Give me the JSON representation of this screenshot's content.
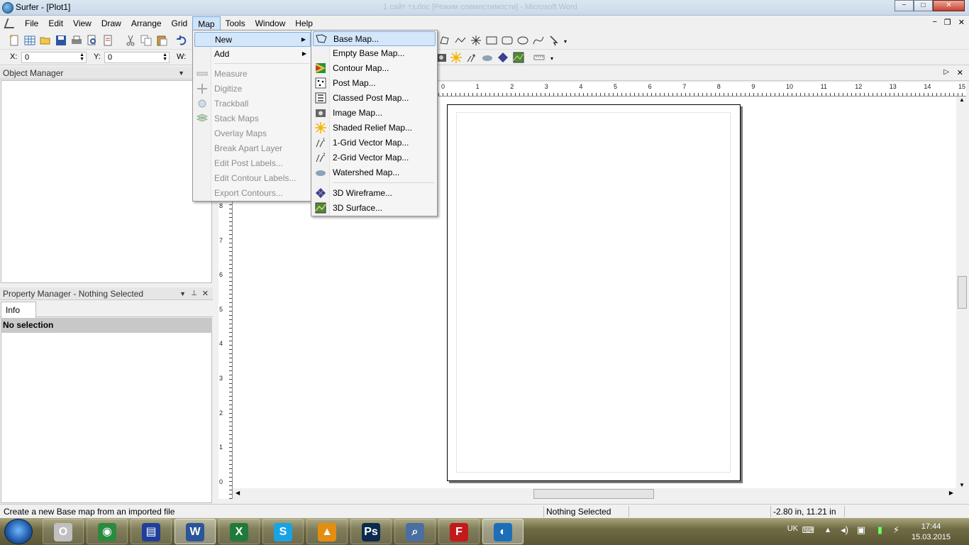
{
  "window": {
    "title": "Surfer - [Plot1]",
    "background_title": "1 сайт тз.doc [Режим совместимости] - Microsoft Word",
    "min": "−",
    "max": "□",
    "close": "✕"
  },
  "menubar": {
    "items": [
      "File",
      "Edit",
      "View",
      "Draw",
      "Arrange",
      "Grid",
      "Map",
      "Tools",
      "Window",
      "Help"
    ],
    "mdi": [
      "−",
      "❐",
      "✕"
    ]
  },
  "coords": {
    "x_label": "X:",
    "x_value": "0",
    "y_label": "Y:",
    "y_value": "0",
    "w_label": "W:"
  },
  "object_manager": {
    "title": "Object Manager"
  },
  "property_manager": {
    "title": "Property Manager - Nothing Selected",
    "tab": "Info",
    "selection": "No selection"
  },
  "map_menu": {
    "items": [
      {
        "label": "New",
        "submenu": true,
        "enabled": true
      },
      {
        "label": "Add",
        "submenu": true,
        "enabled": true
      },
      {
        "label": "Measure",
        "enabled": false
      },
      {
        "label": "Digitize",
        "enabled": false
      },
      {
        "label": "Trackball",
        "enabled": false
      },
      {
        "label": "Stack Maps",
        "enabled": false
      },
      {
        "label": "Overlay Maps",
        "enabled": false
      },
      {
        "label": "Break Apart Layer",
        "enabled": false
      },
      {
        "label": "Edit Post Labels...",
        "enabled": false
      },
      {
        "label": "Edit Contour Labels...",
        "enabled": false
      },
      {
        "label": "Export Contours...",
        "enabled": false
      }
    ]
  },
  "new_submenu": {
    "items": [
      {
        "label": "Base Map...",
        "icon": "base-map-icon"
      },
      {
        "label": "Empty Base Map...",
        "icon": "none"
      },
      {
        "label": "Contour Map...",
        "icon": "contour-map-icon"
      },
      {
        "label": "Post Map...",
        "icon": "post-map-icon"
      },
      {
        "label": "Classed Post Map...",
        "icon": "classed-post-map-icon"
      },
      {
        "label": "Image Map...",
        "icon": "image-map-icon"
      },
      {
        "label": "Shaded Relief Map...",
        "icon": "shaded-relief-icon"
      },
      {
        "label": "1-Grid Vector Map...",
        "icon": "vector-1-icon"
      },
      {
        "label": "2-Grid Vector Map...",
        "icon": "vector-2-icon"
      },
      {
        "label": "Watershed Map...",
        "icon": "watershed-icon"
      },
      {
        "label": "3D Wireframe...",
        "icon": "wireframe-icon"
      },
      {
        "label": "3D Surface...",
        "icon": "surface-icon"
      }
    ]
  },
  "ruler": {
    "h_ticks": [
      "0",
      "1",
      "2",
      "3",
      "4",
      "5",
      "6",
      "7",
      "8",
      "9",
      "10",
      "11",
      "12",
      "13",
      "14",
      "15"
    ],
    "v_ticks": [
      "8",
      "7",
      "6",
      "5",
      "4",
      "3",
      "2",
      "1",
      "0"
    ]
  },
  "status": {
    "hint": "Create a new Base map from an imported file",
    "selection": "Nothing Selected",
    "cursor": "-2.80 in, 11.21 in"
  },
  "taskbar": {
    "apps": [
      {
        "name": "opera",
        "glyph": "O",
        "color": "#c0c0c0"
      },
      {
        "name": "chrome",
        "glyph": "◉",
        "color": "#2a8a3e"
      },
      {
        "name": "save-disk",
        "glyph": "▤",
        "color": "#1f3f9b"
      },
      {
        "name": "word",
        "glyph": "W",
        "color": "#2a5699"
      },
      {
        "name": "excel",
        "glyph": "X",
        "color": "#1f7a3b"
      },
      {
        "name": "skype",
        "glyph": "S",
        "color": "#1aa3e4"
      },
      {
        "name": "aimp",
        "glyph": "▲",
        "color": "#e38e12"
      },
      {
        "name": "photoshop",
        "glyph": "Ps",
        "color": "#0b2a4d"
      },
      {
        "name": "search-tool",
        "glyph": "⌕",
        "color": "#4a6fa1"
      },
      {
        "name": "filezilla",
        "glyph": "F",
        "color": "#c21a1a"
      },
      {
        "name": "surfer",
        "glyph": "◐",
        "color": "#1c6fb7"
      }
    ],
    "lang": "UK",
    "time": "17:44",
    "date": "15.03.2015"
  }
}
